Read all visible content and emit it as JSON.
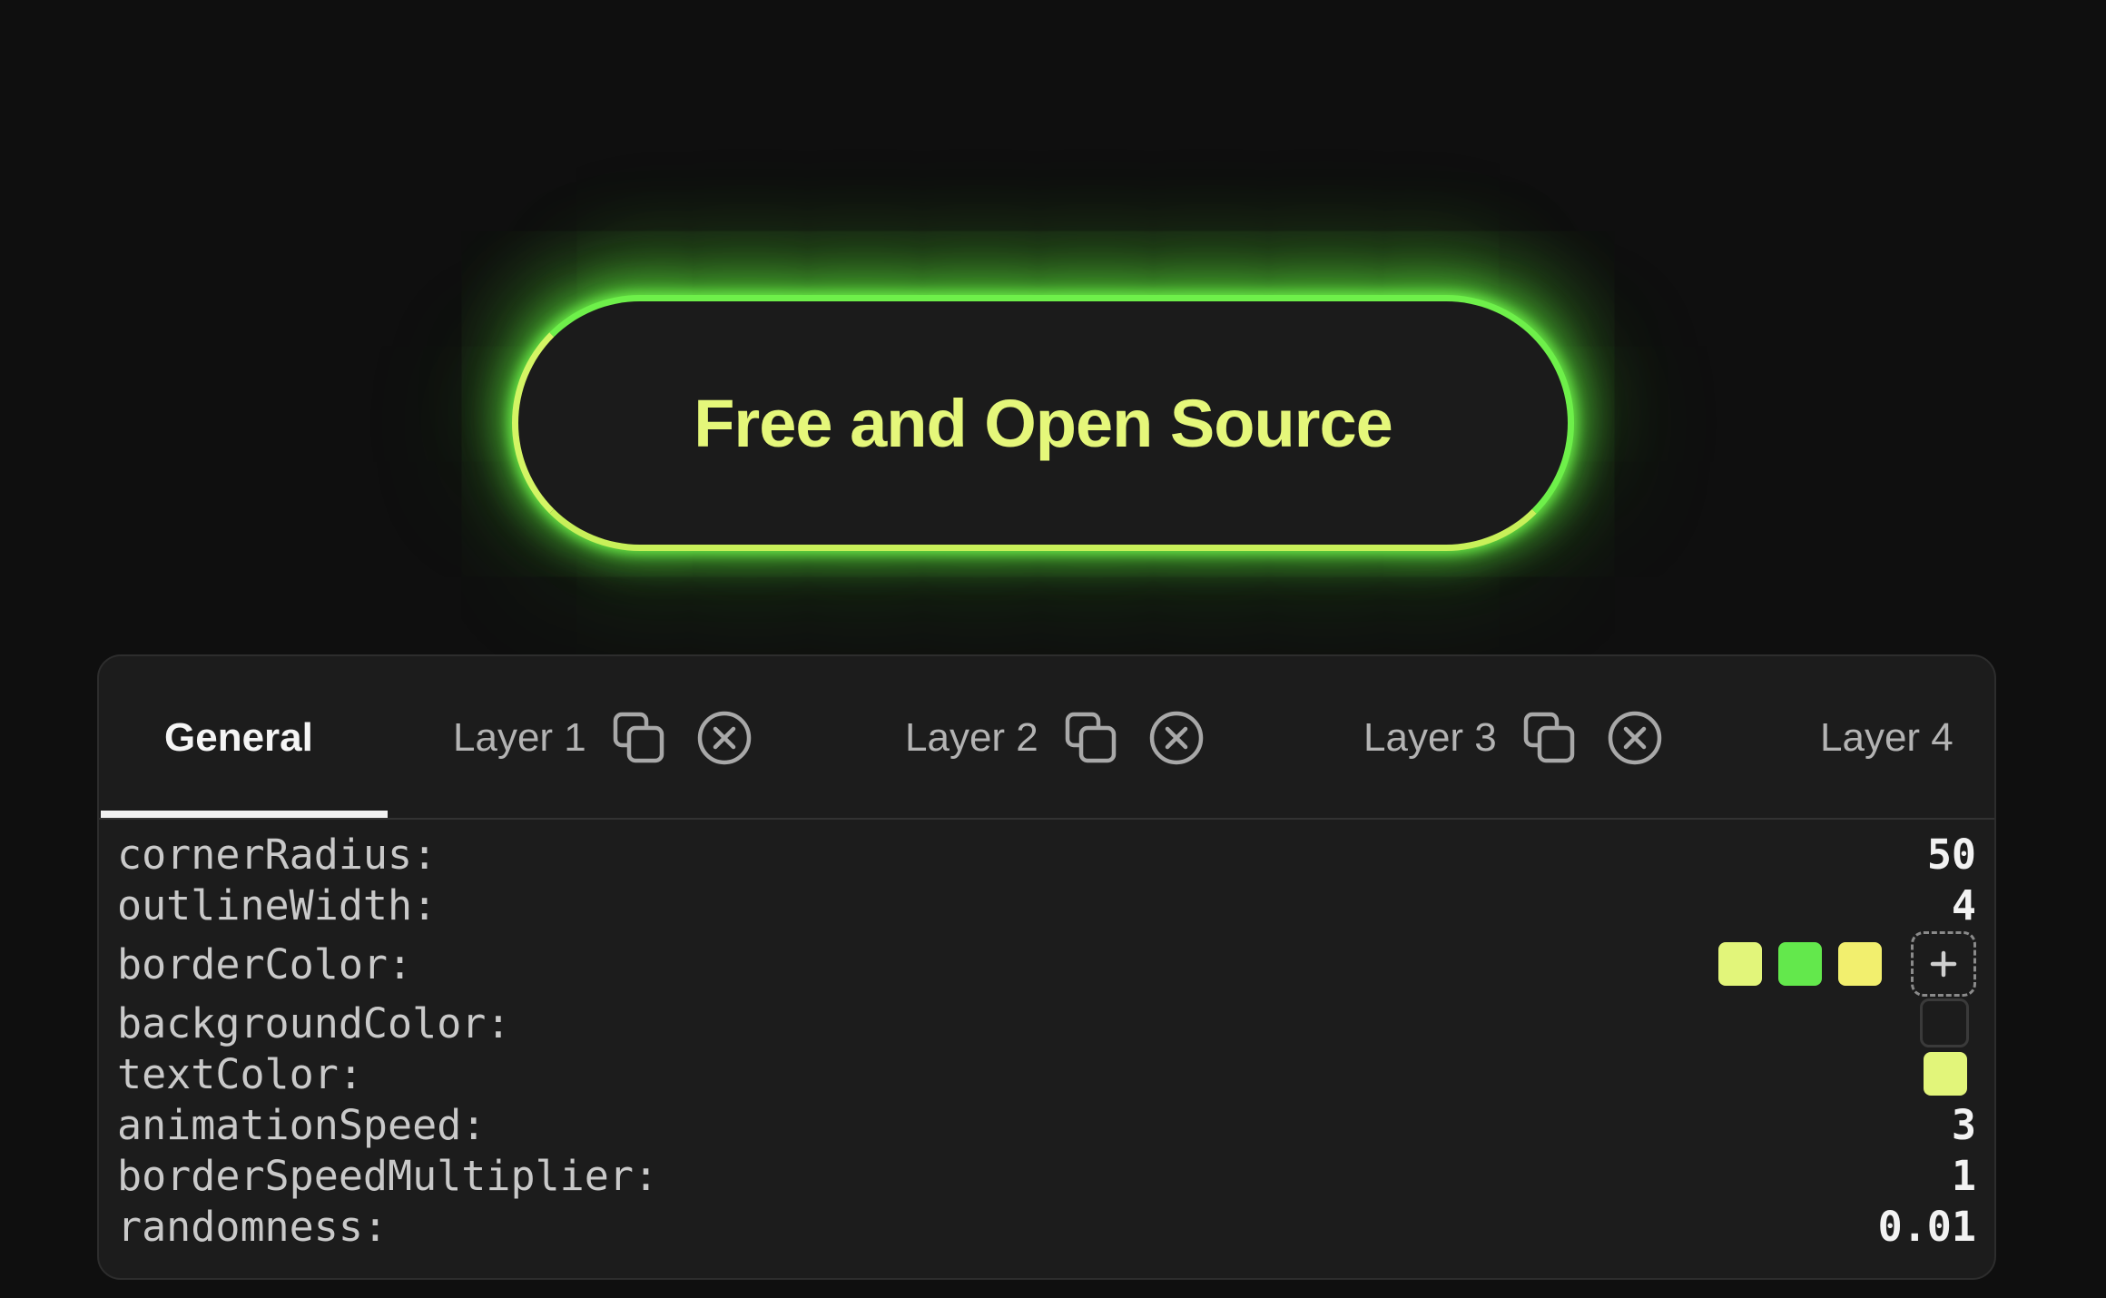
{
  "preview": {
    "button_label": "Free and Open Source"
  },
  "tabs": [
    {
      "label": "General",
      "active": true
    },
    {
      "label": "Layer 1",
      "active": false,
      "icons": [
        "copy-icon",
        "close-circle-icon"
      ]
    },
    {
      "label": "Layer 2",
      "active": false,
      "icons": [
        "copy-icon",
        "close-circle-icon"
      ]
    },
    {
      "label": "Layer 3",
      "active": false,
      "icons": [
        "copy-icon",
        "close-circle-icon"
      ]
    },
    {
      "label": "Layer 4",
      "active": false
    }
  ],
  "properties": {
    "cornerRadius": {
      "label": "cornerRadius:",
      "value": "50"
    },
    "outlineWidth": {
      "label": "outlineWidth:",
      "value": "4"
    },
    "borderColor": {
      "label": "borderColor:",
      "colors": [
        "#e2f57a",
        "#63e84c",
        "#f2ef6e"
      ],
      "add_icon": "plus-icon"
    },
    "backgroundColor": {
      "label": "backgroundColor:",
      "color": "transparent"
    },
    "textColor": {
      "label": "textColor:",
      "color": "#e2f57a"
    },
    "animationSpeed": {
      "label": "animationSpeed:",
      "value": "3"
    },
    "borderSpeedMultiplier": {
      "label": "borderSpeedMultiplier:",
      "value": "1"
    },
    "randomness": {
      "label": "randomness:",
      "value": "0.01"
    }
  },
  "colors": {
    "page_background": "#0f0f0f",
    "glow_green": "#6ef04a",
    "accent_yellow_green": "#e5f77a",
    "panel_background": "#1c1c1c"
  }
}
